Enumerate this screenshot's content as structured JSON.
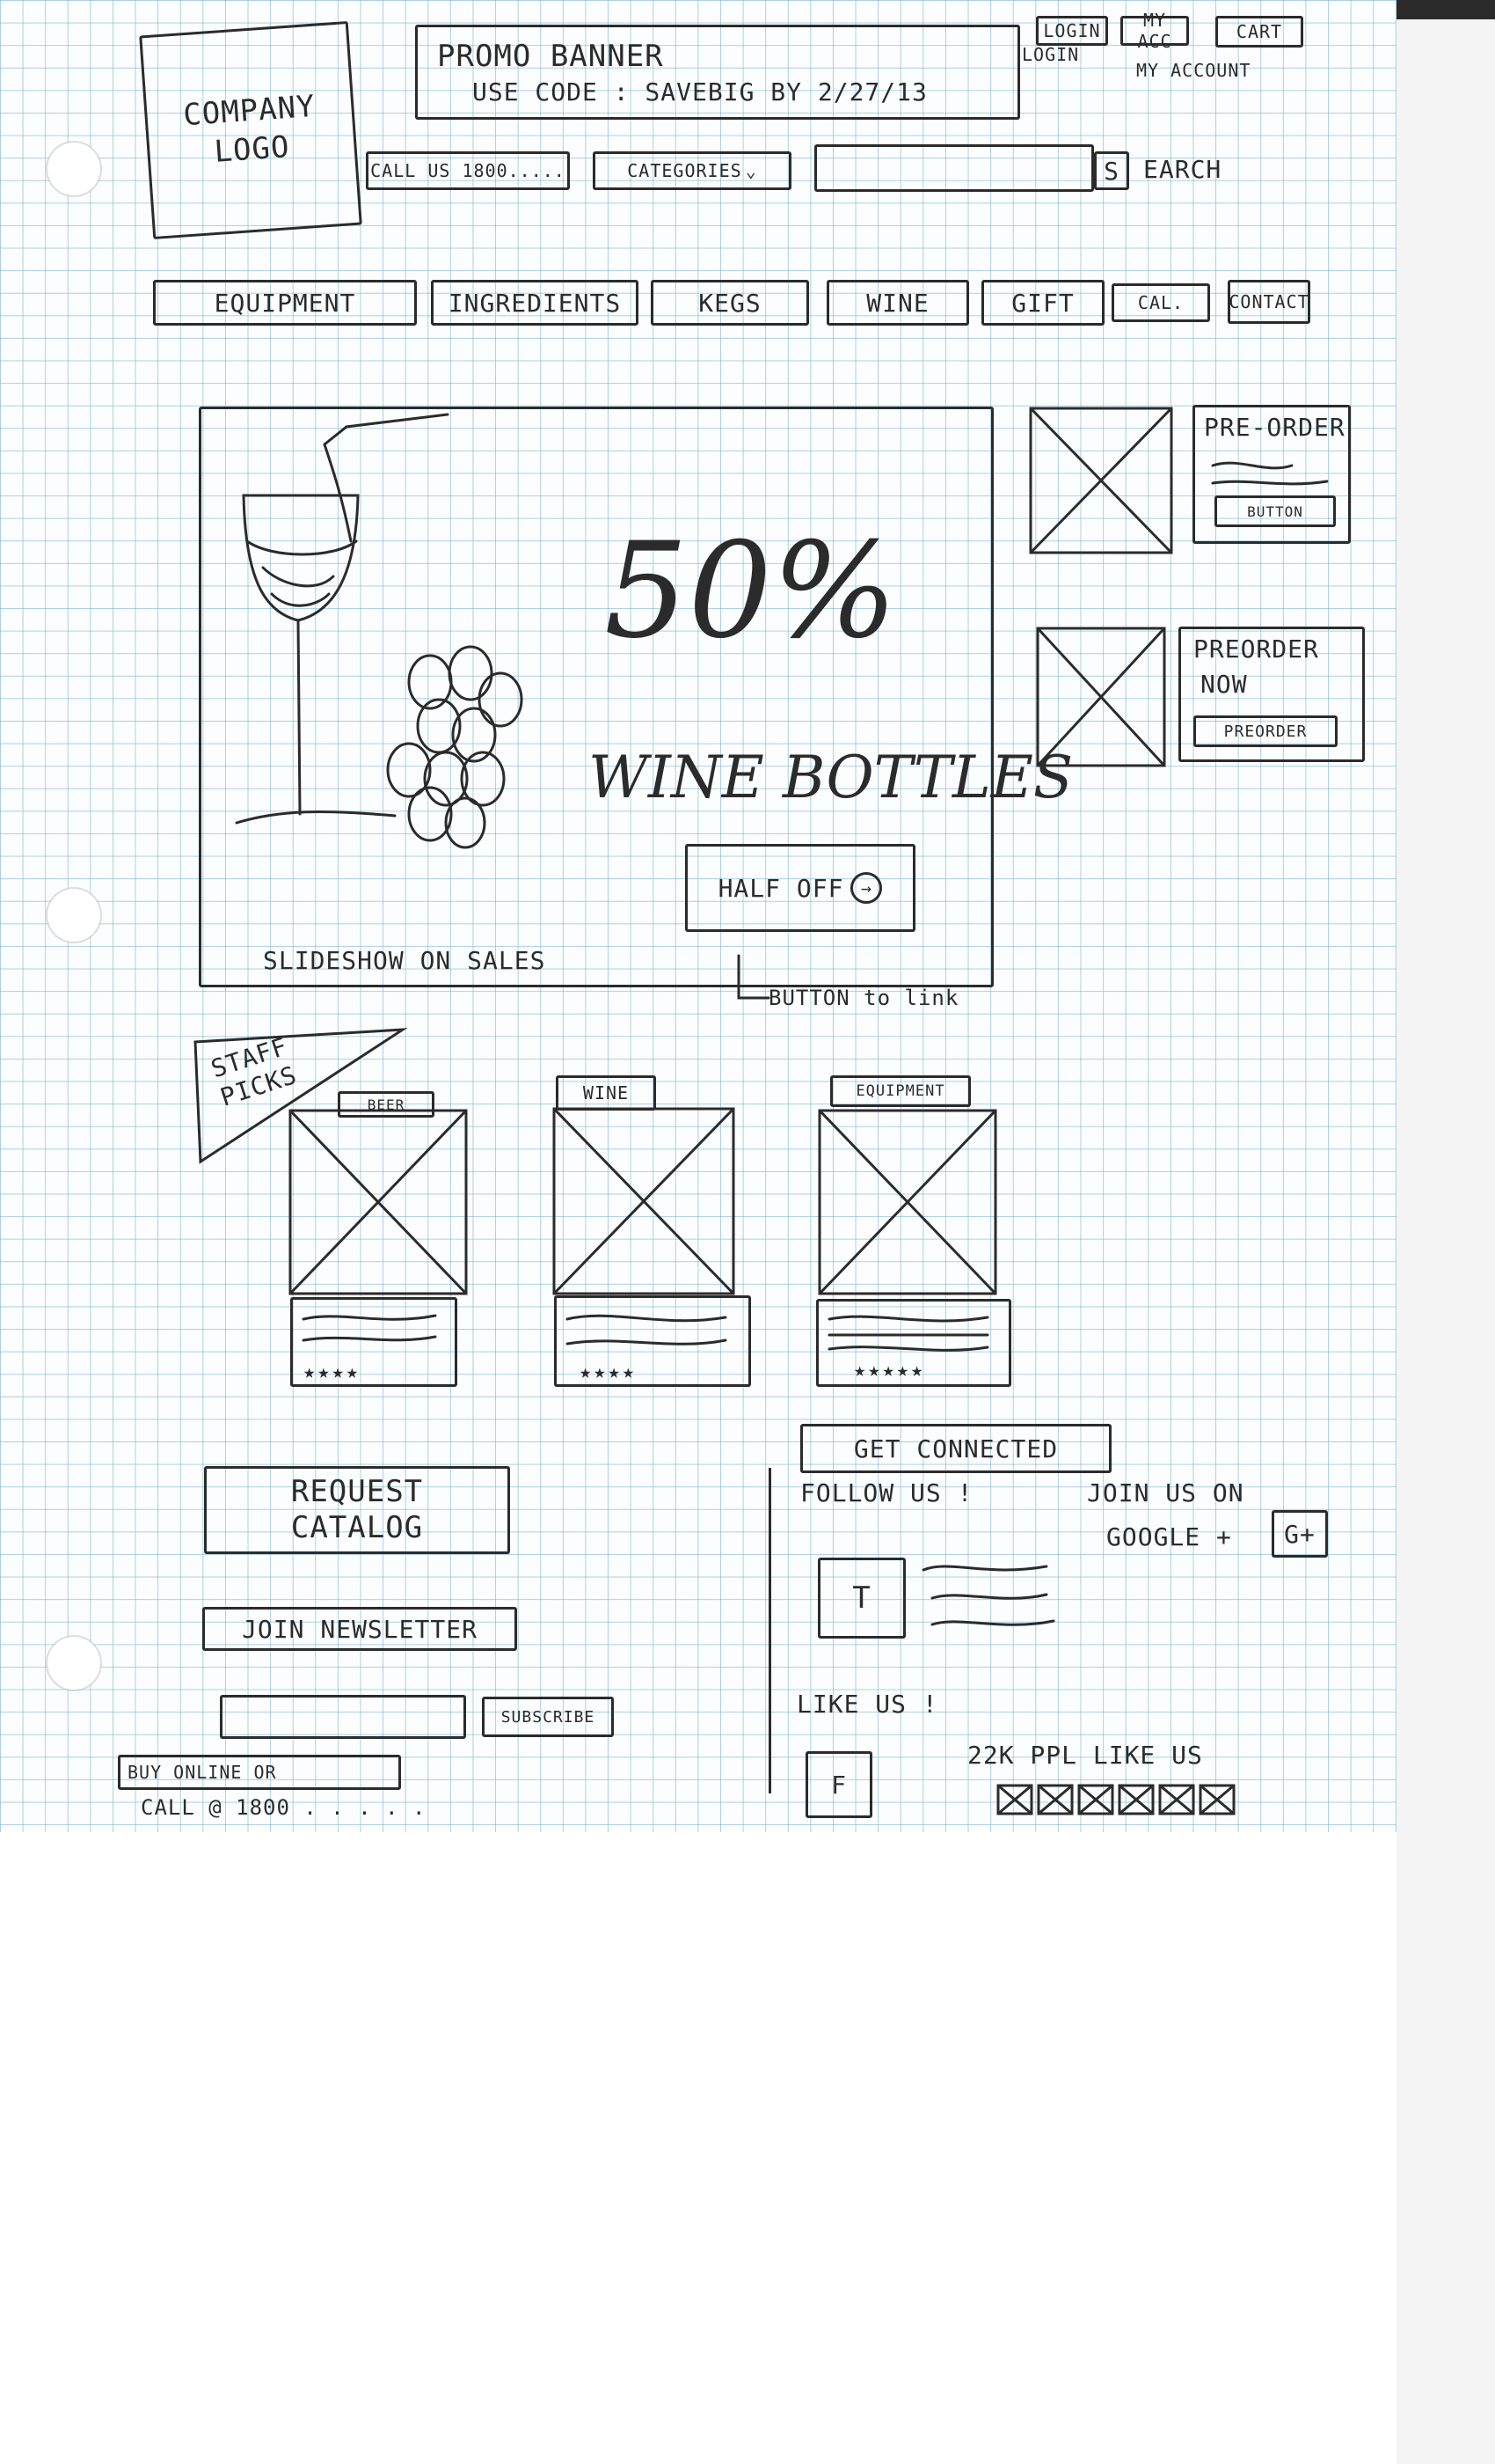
{
  "header": {
    "logo": "COMPANY LOGO",
    "promo_title": "PROMO BANNER",
    "promo_code": "USE CODE : SAVEBIG BY 2/27/13",
    "utility_links": [
      "LOGIN",
      "MY ACC",
      "CART"
    ],
    "utility_notes": [
      "LOGIN",
      "MY ACCOUNT"
    ],
    "call_us": "CALL US 1800.....",
    "categories": "CATEGORIES",
    "search_placeholder": "",
    "search_button": "S",
    "search_label": "EARCH"
  },
  "nav": {
    "items": [
      "EQUIPMENT",
      "INGREDIENTS",
      "KEGS",
      "WINE",
      "GIFT",
      "CAL.",
      "CONTACT"
    ]
  },
  "hero": {
    "percent": "50%",
    "headline": "WINE BOTTLES",
    "button_label": "HALF OFF",
    "caption": "SLIDESHOW ON SALES",
    "annotation": "BUTTON to link"
  },
  "side_promos": [
    {
      "title": "PRE-ORDER",
      "button": "BUTTON"
    },
    {
      "title": "PREORDER",
      "subtitle": "NOW",
      "button": "PREORDER"
    }
  ],
  "staff_picks": {
    "label": "STAFF PICKS",
    "products": [
      {
        "tag": "BEER",
        "rating": 4
      },
      {
        "tag": "WINE",
        "rating": 4
      },
      {
        "tag": "EQUIPMENT",
        "rating": 5
      }
    ]
  },
  "left_column": {
    "catalog": "REQUEST CATALOG",
    "newsletter_label": "JOIN NEWSLETTER",
    "newsletter_placeholder": "",
    "subscribe": "SUBSCRIBE",
    "buy_online": "BUY ONLINE OR",
    "call_line": "CALL @ 1800 . . . . ."
  },
  "connect": {
    "title": "GET CONNECTED",
    "follow": "FOLLOW US !",
    "google_line1": "JOIN US ON",
    "google_line2": "GOOGLE +",
    "google_icon": "G+",
    "twitter_icon": "T",
    "likes": "LIKE US !",
    "facebook_icon": "F",
    "like_count": "22K PPL LIKE US"
  },
  "colors": {
    "ink": "#2b2b2b",
    "grid": "#6eaacd",
    "paper": "#fbfdfe"
  },
  "icons": [
    "gear-icon",
    "arrow-right-icon",
    "star-icon",
    "image-placeholder-icon",
    "twitter-icon",
    "facebook-icon",
    "google-plus-icon"
  ]
}
